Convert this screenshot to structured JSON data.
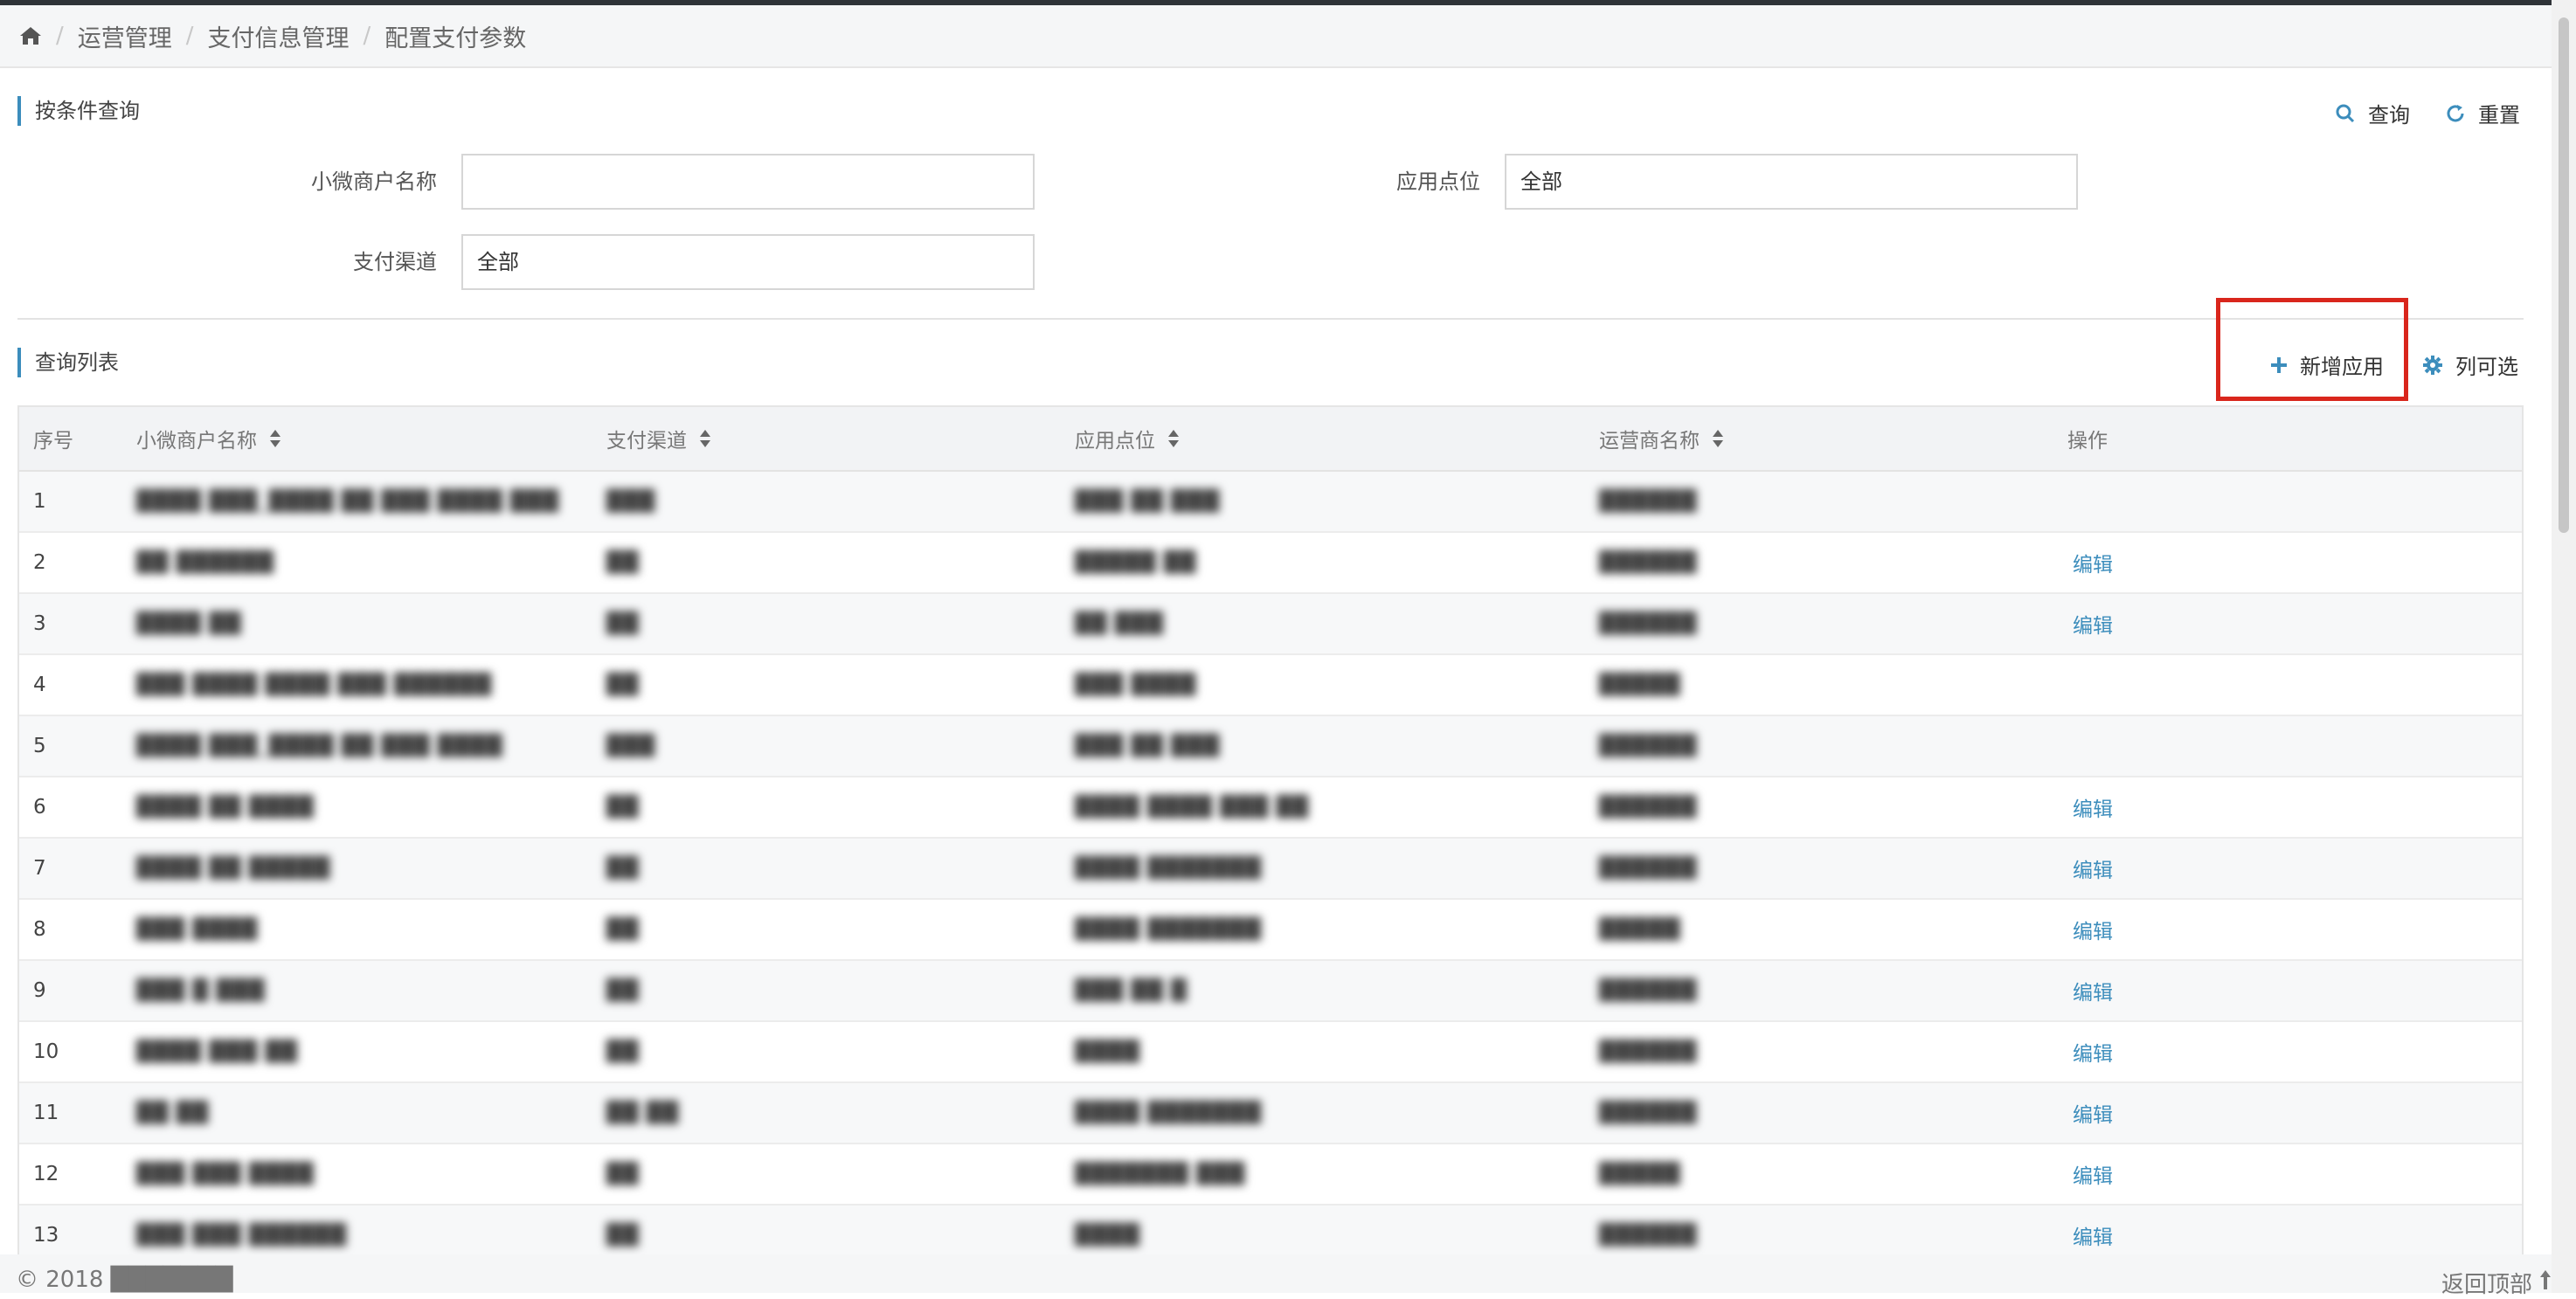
{
  "breadcrumb": {
    "items": [
      "运营管理",
      "支付信息管理",
      "配置支付参数"
    ],
    "separator": "/"
  },
  "query": {
    "title": "按条件查询",
    "search_label": "查询",
    "reset_label": "重置",
    "fields": {
      "merchant_label": "小微商户名称",
      "merchant_value": "",
      "app_point_label": "应用点位",
      "app_point_value": "全部",
      "channel_label": "支付渠道",
      "channel_value": "全部"
    }
  },
  "list": {
    "title": "查询列表",
    "add_label": "新增应用",
    "columns_label": "列可选",
    "headers": [
      "序号",
      "小微商户名称",
      "支付渠道",
      "应用点位",
      "运营商名称",
      "操作"
    ],
    "edit_label": "编辑",
    "rows": [
      {
        "no": "1",
        "merchant": "████ ███_████ ██ ███ ████ ███",
        "channel": "███",
        "point": "███ ██ ███",
        "operator": "██████",
        "edit": false
      },
      {
        "no": "2",
        "merchant": "██ ██████",
        "channel": "██",
        "point": "█████ ██",
        "operator": "██████",
        "edit": true
      },
      {
        "no": "3",
        "merchant": "████ ██",
        "channel": "██",
        "point": "██ ███",
        "operator": "██████",
        "edit": true
      },
      {
        "no": "4",
        "merchant": "███ ████ ████ ███ ██████",
        "channel": "██",
        "point": "███ ████",
        "operator": "█████",
        "edit": false
      },
      {
        "no": "5",
        "merchant": "████ ███_████ ██ ███ ████",
        "channel": "███",
        "point": "███ ██ ███",
        "operator": "██████",
        "edit": false
      },
      {
        "no": "6",
        "merchant": "████ ██ ████",
        "channel": "██",
        "point": "████ ████ ███ ██",
        "operator": "██████",
        "edit": true
      },
      {
        "no": "7",
        "merchant": "████ ██ █████",
        "channel": "██",
        "point": "████ ███████",
        "operator": "██████",
        "edit": true
      },
      {
        "no": "8",
        "merchant": "███ ████",
        "channel": "██",
        "point": "████ ███████",
        "operator": "█████",
        "edit": true
      },
      {
        "no": "9",
        "merchant": "███ █ ███",
        "channel": "██",
        "point": "███ ██ █",
        "operator": "██████",
        "edit": true
      },
      {
        "no": "10",
        "merchant": "████ ███ ██",
        "channel": "██",
        "point": "████",
        "operator": "██████",
        "edit": true
      },
      {
        "no": "11",
        "merchant": "██ ██",
        "channel": "██ ██",
        "point": "████ ███████",
        "operator": "██████",
        "edit": true
      },
      {
        "no": "12",
        "merchant": "███ ███ ████",
        "channel": "██",
        "point": "███████ ███",
        "operator": "█████",
        "edit": true
      },
      {
        "no": "13",
        "merchant": "███ ███ ██████",
        "channel": "██",
        "point": "████",
        "operator": "██████",
        "edit": true
      }
    ]
  },
  "footer": {
    "copyright": "© 2018 ███████",
    "back_to_top": "返回顶部"
  },
  "colors": {
    "accent": "#3c8dbc",
    "highlight": "#d9261c"
  },
  "icons": {
    "home": "home-icon",
    "search": "search-icon",
    "reset": "refresh-icon",
    "add": "plus-icon",
    "columns": "gear-icon",
    "sort": "sort-icon",
    "back_to_top": "arrow-up-icon"
  }
}
